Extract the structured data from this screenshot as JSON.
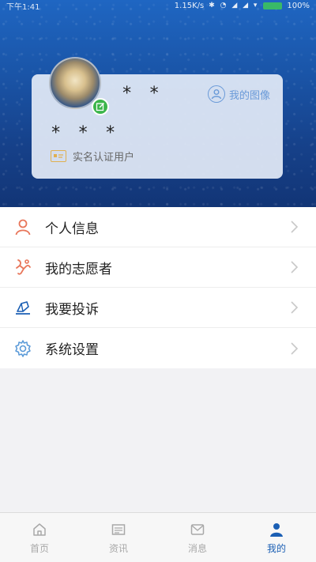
{
  "status_bar": {
    "time": "下午1:41",
    "speed": "1.15K/s",
    "battery": "100%"
  },
  "profile": {
    "username": "* *",
    "real_name": "* * *",
    "my_image_label": "我的图像",
    "verified_label": "实名认证用户"
  },
  "menu": {
    "items": [
      {
        "label": "个人信息",
        "icon": "person-icon"
      },
      {
        "label": "我的志愿者",
        "icon": "volunteer-icon"
      },
      {
        "label": "我要投诉",
        "icon": "complaint-icon"
      },
      {
        "label": "系统设置",
        "icon": "gear-icon"
      }
    ]
  },
  "tabbar": {
    "tabs": [
      {
        "label": "首页",
        "icon": "home-icon",
        "active": false
      },
      {
        "label": "资讯",
        "icon": "news-icon",
        "active": false
      },
      {
        "label": "消息",
        "icon": "message-icon",
        "active": false
      },
      {
        "label": "我的",
        "icon": "profile-icon",
        "active": true
      }
    ]
  },
  "colors": {
    "brand_blue": "#1b5fb4",
    "accent_orange": "#e8765a",
    "verified_gold": "#e0b050",
    "badge_green": "#3bb54a"
  }
}
